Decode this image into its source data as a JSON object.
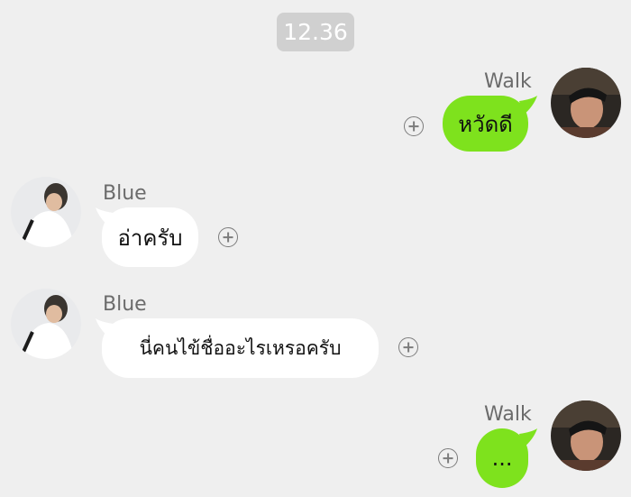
{
  "timestamp": "12.36",
  "messages": [
    {
      "sender": "Walk",
      "text": "หวัดดี",
      "side": "right"
    },
    {
      "sender": "Blue",
      "text": "อ่าครับ",
      "side": "left"
    },
    {
      "sender": "Blue",
      "text": "นี่คนไข้ชื่ออะไรเหรอครับ",
      "side": "left"
    },
    {
      "sender": "Walk",
      "text": "...",
      "side": "right"
    }
  ],
  "colors": {
    "background": "#efefef",
    "outgoing_bubble": "#7ee21d",
    "incoming_bubble": "#ffffff"
  }
}
